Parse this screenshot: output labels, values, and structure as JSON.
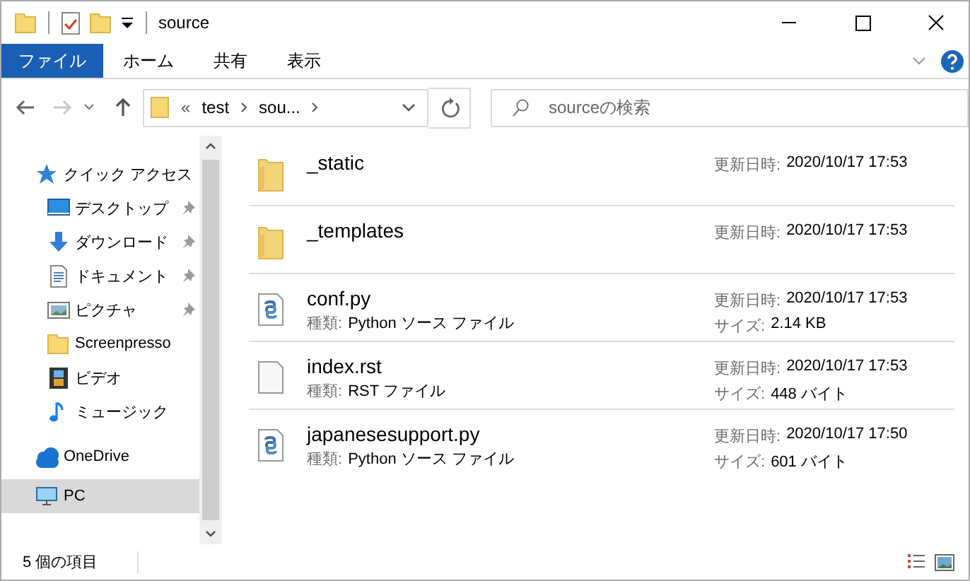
{
  "window": {
    "title": "source"
  },
  "ribbon_tabs": [
    {
      "label": "ファイル",
      "selected": true
    },
    {
      "label": "ホーム",
      "selected": false
    },
    {
      "label": "共有",
      "selected": false
    },
    {
      "label": "表示",
      "selected": false
    }
  ],
  "navigation": {
    "back_disabled": false,
    "forward_disabled": true
  },
  "address": {
    "overflow": "«",
    "crumbs": [
      "test",
      "sou..."
    ]
  },
  "search": {
    "placeholder": "sourceの検索"
  },
  "sidebar": {
    "items": [
      {
        "label": "クイック アクセス",
        "selected": false,
        "children": [
          {
            "label": "デスクトップ",
            "pinned": true,
            "selected": false
          },
          {
            "label": "ダウンロード",
            "pinned": true,
            "selected": false
          },
          {
            "label": "ドキュメント",
            "pinned": true,
            "selected": false
          },
          {
            "label": "ピクチャ",
            "pinned": true,
            "selected": false
          },
          {
            "label": "Screenpresso",
            "pinned": false,
            "selected": false
          },
          {
            "label": "ビデオ",
            "pinned": false,
            "selected": false
          },
          {
            "label": "ミュージック",
            "pinned": false,
            "selected": false
          }
        ]
      },
      {
        "label": "OneDrive",
        "selected": false
      },
      {
        "label": "PC",
        "selected": true
      }
    ]
  },
  "files": [
    {
      "kind": "folder",
      "name": "_static",
      "modified_label": "更新日時:",
      "modified": "2020/10/17 17:53"
    },
    {
      "kind": "folder",
      "name": "_templates",
      "modified_label": "更新日時:",
      "modified": "2020/10/17 17:53"
    },
    {
      "kind": "python",
      "name": "conf.py",
      "type_label": "種類:",
      "type": "Python ソース ファイル",
      "modified_label": "更新日時:",
      "modified": "2020/10/17 17:53",
      "size_label": "サイズ:",
      "size": "2.14 KB"
    },
    {
      "kind": "text",
      "name": "index.rst",
      "type_label": "種類:",
      "type": "RST ファイル",
      "modified_label": "更新日時:",
      "modified": "2020/10/17 17:53",
      "size_label": "サイズ:",
      "size": "448 バイト"
    },
    {
      "kind": "python",
      "name": "japanesesupport.py",
      "type_label": "種類:",
      "type": "Python ソース ファイル",
      "modified_label": "更新日時:",
      "modified": "2020/10/17 17:50",
      "size_label": "サイズ:",
      "size": "601 バイト"
    }
  ],
  "status_bar": {
    "item_count": "5 個の項目"
  }
}
